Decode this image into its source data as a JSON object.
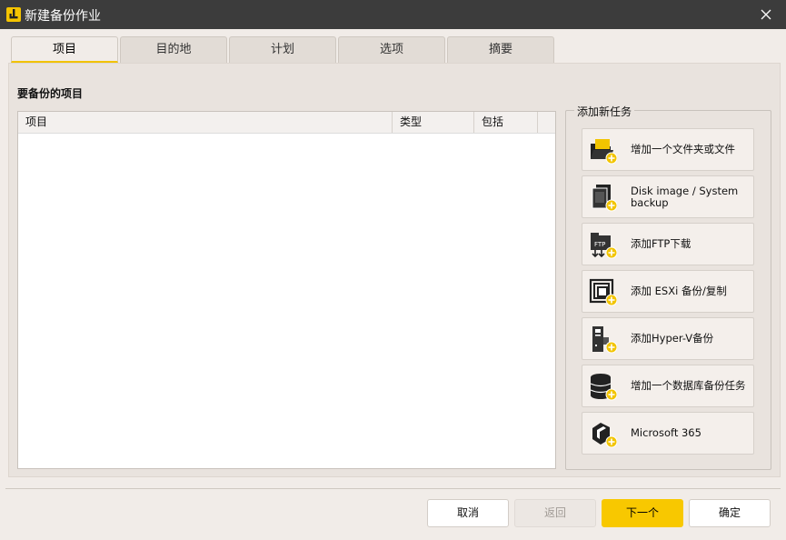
{
  "window": {
    "title": "新建备份作业"
  },
  "tabs": [
    {
      "label": "项目"
    },
    {
      "label": "目的地"
    },
    {
      "label": "计划"
    },
    {
      "label": "选项"
    },
    {
      "label": "摘要"
    }
  ],
  "active_tab": "项目",
  "items_section": {
    "title": "要备份的项目",
    "columns": [
      "项目",
      "类型",
      "包括"
    ]
  },
  "add_task": {
    "title": "添加新任务",
    "buttons": [
      {
        "label": "增加一个文件夹或文件",
        "icon": "folder-file-icon"
      },
      {
        "label": "Disk image / System backup",
        "icon": "disk-image-icon"
      },
      {
        "label": "添加FTP下载",
        "icon": "ftp-icon"
      },
      {
        "label": "添加 ESXi 备份/复制",
        "icon": "esxi-icon"
      },
      {
        "label": "添加Hyper-V备份",
        "icon": "hyperv-icon"
      },
      {
        "label": "增加一个数据库备份任务",
        "icon": "database-icon"
      },
      {
        "label": "Microsoft 365",
        "icon": "microsoft365-icon"
      }
    ]
  },
  "footer": {
    "cancel": "取消",
    "back": "返回",
    "next": "下一个",
    "ok": "确定"
  },
  "colors": {
    "accent": "#f8c800",
    "titlebar": "#3c3c3c"
  }
}
